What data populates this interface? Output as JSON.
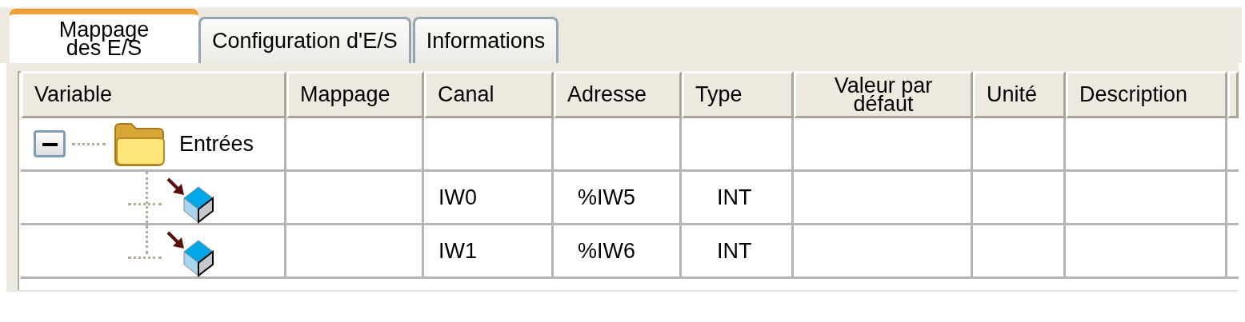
{
  "tabs": [
    {
      "label": "Mappage des E/S",
      "selected": true
    },
    {
      "label": "Configuration d'E/S",
      "selected": false
    },
    {
      "label": "Informations",
      "selected": false
    }
  ],
  "table": {
    "columns": [
      "Variable",
      "Mappage",
      "Canal",
      "Adresse",
      "Type",
      "Valeur par défaut",
      "Unité",
      "Description"
    ],
    "rows": [
      {
        "variable": "Entrées",
        "expanded": true,
        "children": [
          {
            "channel": "IW0",
            "address": "%IW5",
            "type": "INT"
          },
          {
            "channel": "IW1",
            "address": "%IW6",
            "type": "INT"
          }
        ]
      }
    ]
  }
}
